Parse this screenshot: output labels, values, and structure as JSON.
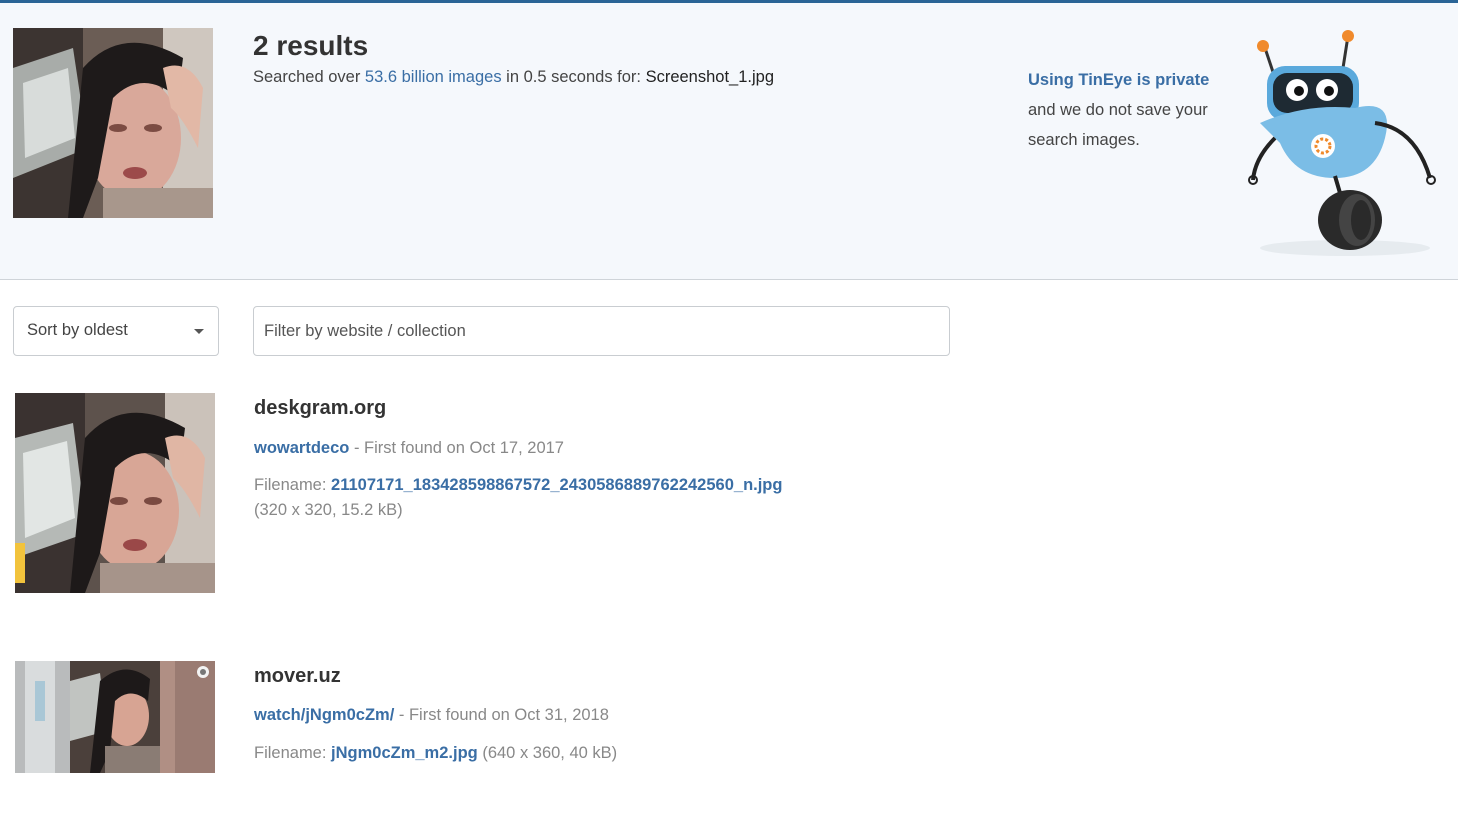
{
  "header": {
    "results_count": "2 results",
    "meta_prefix": "Searched over ",
    "meta_link": "53.6 billion images",
    "meta_middle": " in 0.5 seconds for: ",
    "meta_filename": "Screenshot_1.jpg",
    "privacy_link": "Using TinEye is private",
    "privacy_text": "and we do not save your search images."
  },
  "controls": {
    "sort_label": "Sort by oldest",
    "filter_placeholder": "Filter by website / collection"
  },
  "results": [
    {
      "domain": "deskgram.org",
      "source_link": "wowartdeco",
      "found_text": " - First found on Oct 17, 2017",
      "filename_label": "Filename: ",
      "filename": "21107171_183428598867572_2430586889762242560_n.jpg",
      "details": "(320 x 320, 15.2 kB)"
    },
    {
      "domain": "mover.uz",
      "source_link": "watch/jNgm0cZm/",
      "found_text": " - First found on Oct 31, 2018",
      "filename_label": "Filename: ",
      "filename": "jNgm0cZm_m2.jpg",
      "details": " (640 x 360, 40 kB)"
    }
  ],
  "icons": {
    "robot": "tineye-robot-mascot-icon",
    "caret": "caret-down-icon"
  },
  "colors": {
    "accent": "#3a6ea5",
    "header_bg": "#f5f8fc",
    "topline": "#2a6496"
  }
}
